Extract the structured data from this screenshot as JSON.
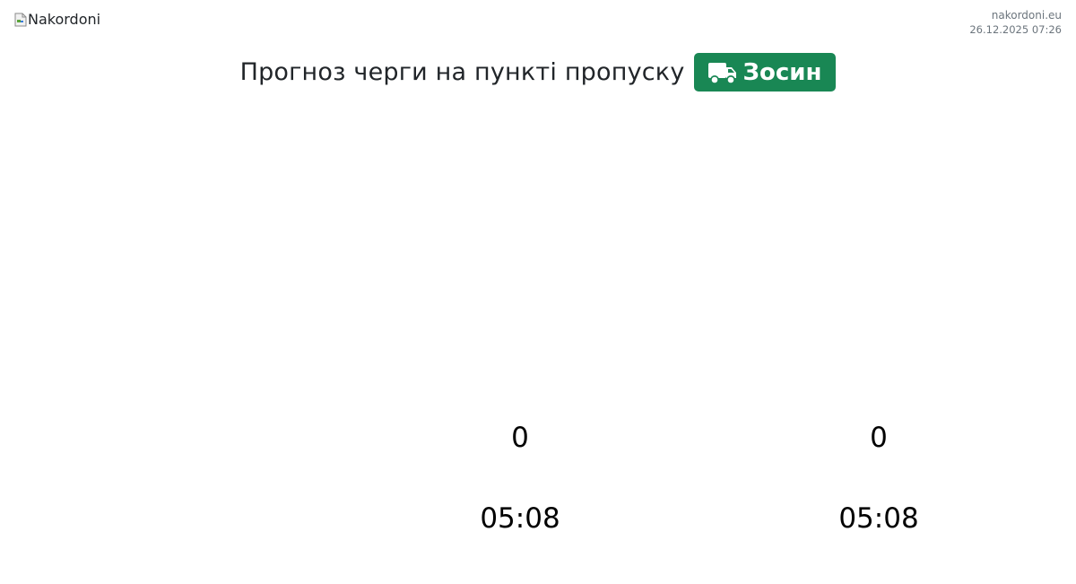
{
  "header": {
    "logo_alt": "Nakordoni",
    "site_domain": "nakordoni.eu",
    "timestamp": "26.12.2025 07:26"
  },
  "title": {
    "text": "Прогноз черги на пункті пропуску",
    "crossing_name": "Зосин",
    "crossing_icon": "truck-icon",
    "badge_color": "#198754"
  },
  "forecast": {
    "columns": [
      {
        "count": "0",
        "time": "05:08"
      },
      {
        "count": "0",
        "time": "05:08"
      }
    ]
  }
}
